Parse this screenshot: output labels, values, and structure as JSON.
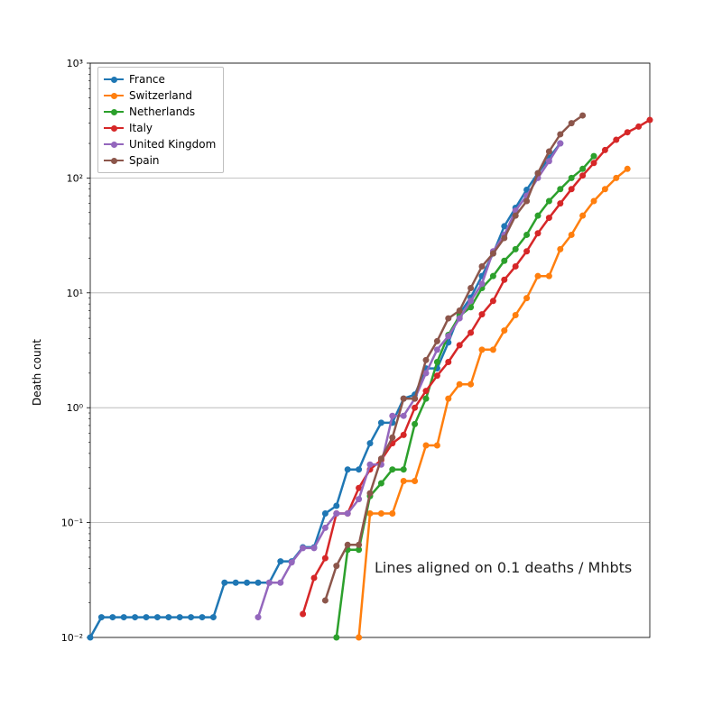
{
  "chart_data": {
    "type": "line",
    "title": "",
    "xlabel": "",
    "ylabel": "Death count",
    "annotation": "Lines aligned on 0.1 deaths / Mhbts",
    "yscale": "log",
    "ylim": [
      0.01,
      1000
    ],
    "yticks": [
      0.01,
      0.1,
      1,
      10,
      100,
      1000
    ],
    "ytick_labels": [
      "10⁻²",
      "10⁻¹",
      "10⁰",
      "10¹",
      "10²",
      "10³"
    ],
    "xlim": [
      0,
      50
    ],
    "series": [
      {
        "name": "France",
        "color": "#1f77b4",
        "x": [
          0,
          1,
          2,
          3,
          4,
          5,
          6,
          7,
          8,
          9,
          10,
          11,
          12,
          13,
          14,
          15,
          16,
          17,
          18,
          19,
          20,
          21,
          22,
          23,
          24,
          25,
          26,
          27,
          28,
          29,
          30,
          31,
          32,
          33,
          34,
          35,
          36,
          37,
          38,
          39,
          40,
          41,
          42
        ],
        "y": [
          0.01,
          0.015,
          0.015,
          0.015,
          0.015,
          0.015,
          0.015,
          0.015,
          0.015,
          0.015,
          0.015,
          0.015,
          0.03,
          0.03,
          0.03,
          0.03,
          0.03,
          0.046,
          0.046,
          0.061,
          0.061,
          0.12,
          0.14,
          0.29,
          0.29,
          0.49,
          0.74,
          0.74,
          1.2,
          1.3,
          2.2,
          2.2,
          3.7,
          6.6,
          9.1,
          14,
          22,
          38,
          55,
          79,
          110,
          150,
          200
        ]
      },
      {
        "name": "Switzerland",
        "color": "#ff7f0e",
        "x": [
          24,
          25,
          26,
          27,
          28,
          29,
          30,
          31,
          32,
          33,
          34,
          35,
          36,
          37,
          38,
          39,
          40,
          41,
          42,
          43,
          44,
          45,
          46,
          47,
          48
        ],
        "y": [
          0.01,
          0.12,
          0.12,
          0.12,
          0.23,
          0.23,
          0.47,
          0.47,
          1.2,
          1.6,
          1.6,
          3.2,
          3.2,
          4.7,
          6.4,
          9,
          14,
          14,
          24,
          32,
          47,
          63,
          80,
          100,
          120
        ]
      },
      {
        "name": "Netherlands",
        "color": "#2ca02c",
        "x": [
          22,
          23,
          24,
          25,
          26,
          27,
          28,
          29,
          30,
          31,
          32,
          33,
          34,
          35,
          36,
          37,
          38,
          39,
          40,
          41,
          42,
          43,
          44,
          45
        ],
        "y": [
          0.01,
          0.058,
          0.058,
          0.17,
          0.22,
          0.29,
          0.29,
          0.72,
          1.2,
          2.5,
          4.3,
          6.3,
          7.5,
          11,
          14,
          19,
          24,
          32,
          47,
          63,
          80,
          100,
          120,
          155
        ]
      },
      {
        "name": "Italy",
        "color": "#d62728",
        "x": [
          19,
          20,
          21,
          22,
          23,
          24,
          25,
          26,
          27,
          28,
          29,
          30,
          31,
          32,
          33,
          34,
          35,
          36,
          37,
          38,
          39,
          40,
          41,
          42,
          43,
          44,
          45,
          46,
          47,
          48,
          49,
          50
        ],
        "y": [
          0.016,
          0.033,
          0.049,
          0.12,
          0.12,
          0.2,
          0.29,
          0.35,
          0.49,
          0.58,
          1.0,
          1.4,
          1.9,
          2.5,
          3.5,
          4.5,
          6.5,
          8.5,
          13,
          17,
          23,
          33,
          45,
          60,
          80,
          105,
          135,
          175,
          215,
          250,
          280,
          320
        ]
      },
      {
        "name": "United Kingdom",
        "color": "#9467bd",
        "x": [
          15,
          16,
          17,
          18,
          19,
          20,
          21,
          22,
          23,
          24,
          25,
          26,
          27,
          28,
          29,
          30,
          31,
          32,
          33,
          34,
          35,
          36,
          37,
          38,
          39,
          40,
          41,
          42
        ],
        "y": [
          0.015,
          0.03,
          0.03,
          0.045,
          0.06,
          0.06,
          0.09,
          0.12,
          0.12,
          0.16,
          0.32,
          0.32,
          0.85,
          0.85,
          1.2,
          2.0,
          3.2,
          4.2,
          6.0,
          8.5,
          12,
          23,
          32,
          52,
          70,
          100,
          140,
          200
        ]
      },
      {
        "name": "Spain",
        "color": "#8c564b",
        "x": [
          21,
          22,
          23,
          24,
          25,
          26,
          27,
          28,
          29,
          30,
          31,
          32,
          33,
          34,
          35,
          36,
          37,
          38,
          39,
          40,
          41,
          42,
          43,
          44
        ],
        "y": [
          0.021,
          0.042,
          0.064,
          0.064,
          0.18,
          0.36,
          0.55,
          1.2,
          1.2,
          2.6,
          3.8,
          6.0,
          7.0,
          11,
          17,
          22,
          30,
          47,
          63,
          110,
          170,
          240,
          300,
          350
        ]
      }
    ]
  },
  "legend_title": ""
}
